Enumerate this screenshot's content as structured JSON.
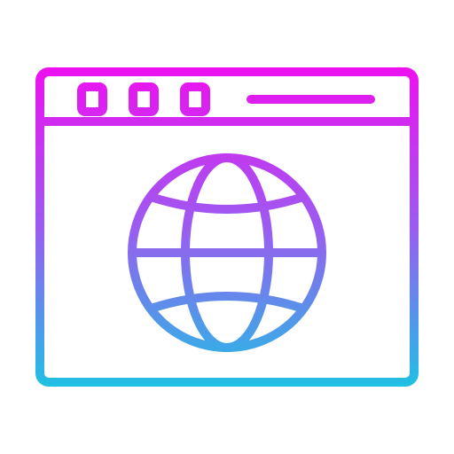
{
  "icon": {
    "name": "web-browser-globe-icon",
    "gradient": {
      "top_color": "#ee10f0",
      "mid_color": "#9b5cf0",
      "bottom_color": "#20c0e4"
    },
    "parts": {
      "window": "browser-window-frame",
      "controls": [
        "window-control-dot",
        "window-control-dot",
        "window-control-dot"
      ],
      "address_bar": "address-bar-line",
      "globe": "globe-icon"
    }
  }
}
